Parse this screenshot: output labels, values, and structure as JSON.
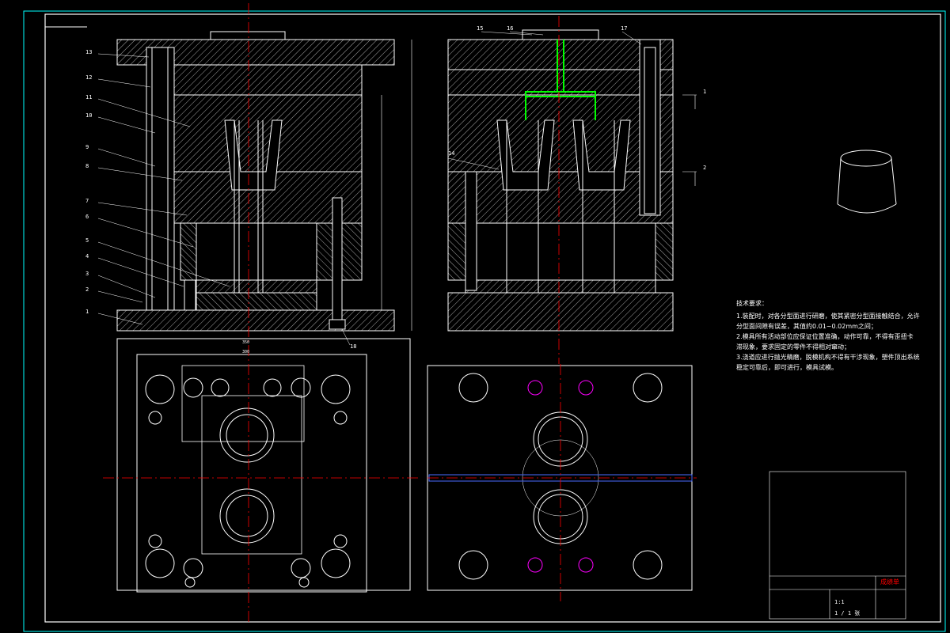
{
  "colors": {
    "background": "#000000",
    "frame": "#00ffff",
    "outline": "#ffffff",
    "centerline": "#ff0000",
    "hatch": "#ffffff",
    "runner": "#00ff00",
    "table": "#ffff00",
    "accent": "#ff00ff"
  },
  "drawing": {
    "part_numbers_left": [
      "13",
      "12",
      "11",
      "10",
      "9",
      "8",
      "7",
      "6",
      "5",
      "4",
      "3",
      "2",
      "1"
    ],
    "part_numbers_right": [
      "15",
      "16",
      "17",
      "14"
    ],
    "part_number_bottom": "18",
    "section_marks": [
      "1",
      "2"
    ],
    "dim_labels": {
      "plan_width_outer": "300",
      "plan_width_inner": "350"
    }
  },
  "notes": {
    "title": "技术要求：",
    "lines": [
      "1.装配时，对各分型面进行研磨，使其紧密分型面接触结合，允许",
      "分型面间隙有误差，其值约0.01~0.02mm之间；",
      "2.模具所有活动部位应保证位置准确，动作可靠，不得有歪扭卡",
      "滞现象，要求固定的零件不得相对窜动；",
      "3.浇道应进行抛光精磨，脱模机构不得有干涉现象，塑件顶出系统",
      "稳定可靠后，即可进行，模具试模。"
    ]
  },
  "title_block": {
    "stamp": "成绩单",
    "scale": "1:1",
    "sheet": "1 / 1 张"
  }
}
